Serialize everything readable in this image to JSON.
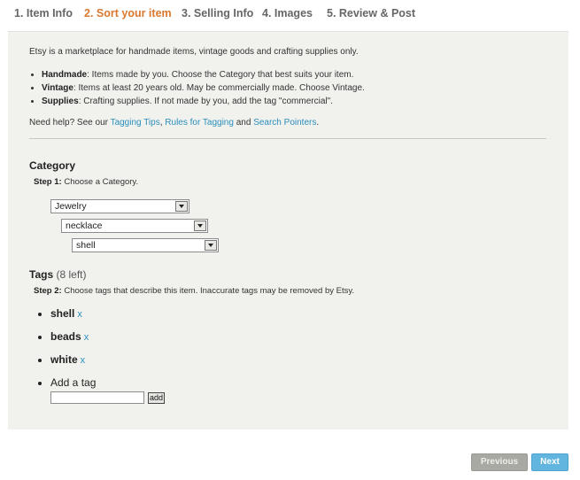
{
  "wizard": {
    "steps": [
      {
        "label": "1. Item Info",
        "active": false
      },
      {
        "label": "2. Sort your item",
        "active": true
      },
      {
        "label": "3. Selling Info",
        "active": false
      },
      {
        "label": "4. Images",
        "active": false
      },
      {
        "label": "5. Review & Post",
        "active": false
      }
    ],
    "active_color": "#d9782e"
  },
  "intro": "Etsy is a marketplace for handmade items, vintage goods and crafting supplies only.",
  "kinds": [
    {
      "term": "Handmade",
      "desc": ": Items made by you. Choose the Category that best suits your item."
    },
    {
      "term": "Vintage",
      "desc": ": Items at least 20 years old. May be commercially made. Choose Vintage."
    },
    {
      "term": "Supplies",
      "desc": ": Crafting supplies. If not made by you, add the tag \"commercial\"."
    }
  ],
  "help": {
    "prefix": "Need help? See our ",
    "link1": "Tagging Tips",
    "sep1": ", ",
    "link2": "Rules for Tagging",
    "sep2": " and ",
    "link3": "Search Pointers",
    "suffix": "."
  },
  "category": {
    "heading": "Category",
    "step_label": "Step 1:",
    "step_text": " Choose a Category.",
    "select1": "Jewelry",
    "select2": "necklace",
    "select3": "shell"
  },
  "tags": {
    "heading": "Tags",
    "remaining": "(8 left)",
    "step_label": "Step 2:",
    "step_text": " Choose tags that describe this item. Inaccurate tags may be removed by Etsy.",
    "items": [
      "shell",
      "beads",
      "white"
    ],
    "remove_label": "x",
    "add_label": "Add a tag",
    "input_value": "",
    "add_button": "add"
  },
  "nav": {
    "previous": "Previous",
    "next": "Next"
  },
  "colors": {
    "link": "#2a8fbd",
    "next_button": "#62b5df",
    "previous_button": "#a9a9a3"
  }
}
